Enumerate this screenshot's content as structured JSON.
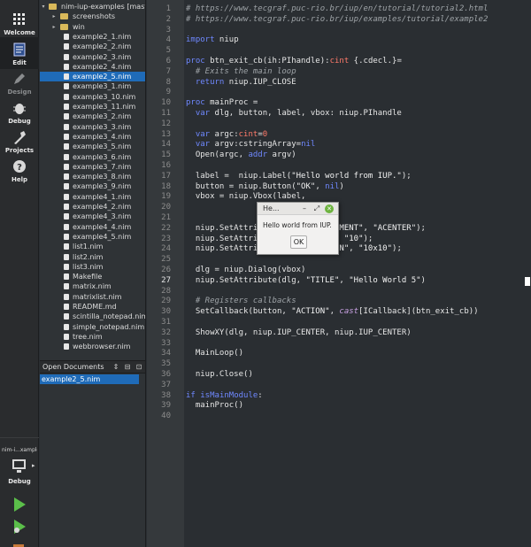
{
  "modebar": {
    "modes": [
      {
        "id": "welcome",
        "label": "Welcome",
        "icon": "grid-icon"
      },
      {
        "id": "edit",
        "label": "Edit",
        "icon": "edit-icon"
      },
      {
        "id": "design",
        "label": "Design",
        "icon": "pencil-icon"
      },
      {
        "id": "debug",
        "label": "Debug",
        "icon": "bug-icon"
      },
      {
        "id": "projects",
        "label": "Projects",
        "icon": "wrench-icon"
      },
      {
        "id": "help",
        "label": "Help",
        "icon": "help-icon"
      }
    ],
    "kit_name": "nim-i...xamples",
    "kit_mode_label": "Debug",
    "accent_run": "#5bbf4a",
    "accent_selection": "#1f6bb8"
  },
  "tree": {
    "root": "nim-iup-examples [maste",
    "folders": [
      "screenshots",
      "win"
    ],
    "files": [
      "example2_1.nim",
      "example2_2.nim",
      "example2_3.nim",
      "example2_4.nim",
      "example2_5.nim",
      "example3_1.nim",
      "example3_10.nim",
      "example3_11.nim",
      "example3_2.nim",
      "example3_3.nim",
      "example3_4.nim",
      "example3_5.nim",
      "example3_6.nim",
      "example3_7.nim",
      "example3_8.nim",
      "example3_9.nim",
      "example4_1.nim",
      "example4_2.nim",
      "example4_3.nim",
      "example4_4.nim",
      "example4_5.nim",
      "list1.nim",
      "list2.nim",
      "list3.nim",
      "Makefile",
      "matrix.nim",
      "matrixlist.nim",
      "README.md",
      "scintilla_notepad.nim",
      "simple_notepad.nim",
      "tree.nim",
      "webbrowser.nim"
    ],
    "selected": "example2_5.nim"
  },
  "open_documents": {
    "title": "Open Documents",
    "items": [
      "example2_5.nim"
    ]
  },
  "editor": {
    "current_line": 27,
    "lines": [
      [
        [
          "cm",
          "# https://www.tecgraf.puc-rio.br/iup/en/tutorial/tutorial2.html"
        ]
      ],
      [
        [
          "cm",
          "# https://www.tecgraf.puc-rio.br/iup/examples/tutorial/example2"
        ]
      ],
      [],
      [
        [
          "kw",
          "import"
        ],
        [
          "",
          " niup"
        ]
      ],
      [],
      [
        [
          "kw",
          "proc"
        ],
        [
          "",
          " btn_exit_cb(ih:PIhandle):"
        ],
        [
          "ty",
          "cint"
        ],
        [
          "",
          " {.cdecl.}="
        ]
      ],
      [
        [
          "cm",
          "  # Exits the main loop"
        ]
      ],
      [
        [
          "",
          "  "
        ],
        [
          "kw",
          "return"
        ],
        [
          "",
          " niup.IUP_CLOSE"
        ]
      ],
      [],
      [
        [
          "kw",
          "proc"
        ],
        [
          "",
          " mainProc ="
        ]
      ],
      [
        [
          "",
          "  "
        ],
        [
          "kw",
          "var"
        ],
        [
          "",
          " dlg, button, label, vbox: niup.PIhandle"
        ]
      ],
      [],
      [
        [
          "",
          "  "
        ],
        [
          "kw",
          "var"
        ],
        [
          "",
          " argc:"
        ],
        [
          "ty",
          "cint"
        ],
        [
          "",
          "="
        ],
        [
          "nu",
          "0"
        ]
      ],
      [
        [
          "",
          "  "
        ],
        [
          "kw",
          "var"
        ],
        [
          "",
          " argv:cstringArray="
        ],
        [
          "kw",
          "nil"
        ]
      ],
      [
        [
          "",
          "  Open(argc, "
        ],
        [
          "kw",
          "addr"
        ],
        [
          "",
          " argv)"
        ]
      ],
      [],
      [
        [
          "",
          "  label =  niup.Label("
        ],
        [
          "st",
          "\"Hello world from IUP.\""
        ],
        [
          "",
          ");"
        ]
      ],
      [
        [
          "",
          "  button = niup.Button("
        ],
        [
          "st",
          "\"OK\""
        ],
        [
          "",
          ", "
        ],
        [
          "kw",
          "nil"
        ],
        [
          "",
          ")"
        ]
      ],
      [
        [
          "",
          "  vbox = niup.Vbox(label,"
        ]
      ],
      [],
      [],
      [
        [
          "",
          "  niup.SetAttribute(vbox, "
        ],
        [
          "st",
          "\"ALIGNMENT\""
        ],
        [
          "",
          ", "
        ],
        [
          "st",
          "\"ACENTER\""
        ],
        [
          "",
          ");"
        ]
      ],
      [
        [
          "",
          "  niup.SetAttribute(vbox, "
        ],
        [
          "st",
          "\"GAP\""
        ],
        [
          "",
          ", "
        ],
        [
          "st",
          "\"10\""
        ],
        [
          "",
          ");"
        ]
      ],
      [
        [
          "",
          "  niup.SetAttribute(vbox, "
        ],
        [
          "st",
          "\"MARGIN\""
        ],
        [
          "",
          ", "
        ],
        [
          "st",
          "\"10x10\""
        ],
        [
          "",
          ");"
        ]
      ],
      [],
      [
        [
          "",
          "  dlg = niup.Dialog(vbox)"
        ]
      ],
      [
        [
          "",
          "  niup.SetAttribute(dlg, "
        ],
        [
          "st",
          "\"TITLE\""
        ],
        [
          "",
          ", "
        ],
        [
          "st",
          "\"Hello World 5\""
        ],
        [
          "",
          ")"
        ]
      ],
      [],
      [
        [
          "cm",
          "  # Registers callbacks"
        ]
      ],
      [
        [
          "",
          "  SetCallback(button, "
        ],
        [
          "st",
          "\"ACTION\""
        ],
        [
          "",
          ", "
        ],
        [
          "ik",
          "cast"
        ],
        [
          "",
          "[ICallback](btn_exit_cb))"
        ]
      ],
      [],
      [
        [
          "",
          "  ShowXY(dlg, niup.IUP_CENTER, niup.IUP_CENTER)"
        ]
      ],
      [],
      [
        [
          "",
          "  MainLoop()"
        ]
      ],
      [],
      [
        [
          "",
          "  niup.Close()"
        ]
      ],
      [],
      [
        [
          "kw",
          "if"
        ],
        [
          "",
          " "
        ],
        [
          "kw",
          "isMainModule"
        ],
        [
          "",
          ":"
        ]
      ],
      [
        [
          "",
          "  mainProc()"
        ]
      ],
      []
    ]
  },
  "dialog": {
    "title": "He...",
    "message": "Hello world from IUP.",
    "ok_label": "OK"
  }
}
